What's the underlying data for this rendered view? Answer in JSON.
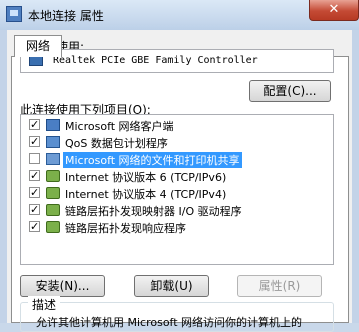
{
  "window": {
    "title": "本地连接 属性",
    "close_glyph": "✕"
  },
  "tabs": [
    {
      "label": "网络"
    }
  ],
  "connect_using": {
    "label": "连接时使用:",
    "adapter": "Realtek PCIe GBE Family Controller",
    "configure_button": "配置(C)..."
  },
  "items": {
    "label": "此连接使用下列项目(O):",
    "list": [
      {
        "checked": true,
        "text": "Microsoft 网络客户端",
        "icon": "network-client-icon"
      },
      {
        "checked": true,
        "text": "QoS 数据包计划程序",
        "icon": "qos-scheduler-icon"
      },
      {
        "checked": false,
        "text": "Microsoft 网络的文件和打印机共享",
        "icon": "file-printer-sharing-icon",
        "selected": true
      },
      {
        "checked": true,
        "text": "Internet 协议版本 6 (TCP/IPv6)",
        "icon": "protocol-icon"
      },
      {
        "checked": true,
        "text": "Internet 协议版本 4 (TCP/IPv4)",
        "icon": "protocol-icon"
      },
      {
        "checked": true,
        "text": "链路层拓扑发现映射器 I/O 驱动程序",
        "icon": "protocol-icon"
      },
      {
        "checked": true,
        "text": "链路层拓扑发现响应程序",
        "icon": "protocol-icon"
      }
    ],
    "check_glyph": "✓"
  },
  "buttons": {
    "install": "安装(N)...",
    "uninstall": "卸载(U)",
    "properties": "属性(R)"
  },
  "description": {
    "title": "描述",
    "text": "允许其他计算机用 Microsoft 网络访问你的计算机上的"
  },
  "colors": {
    "selection": "#3399ff",
    "close_button": "#c44a35",
    "titlebar": "#bcd0e8"
  }
}
